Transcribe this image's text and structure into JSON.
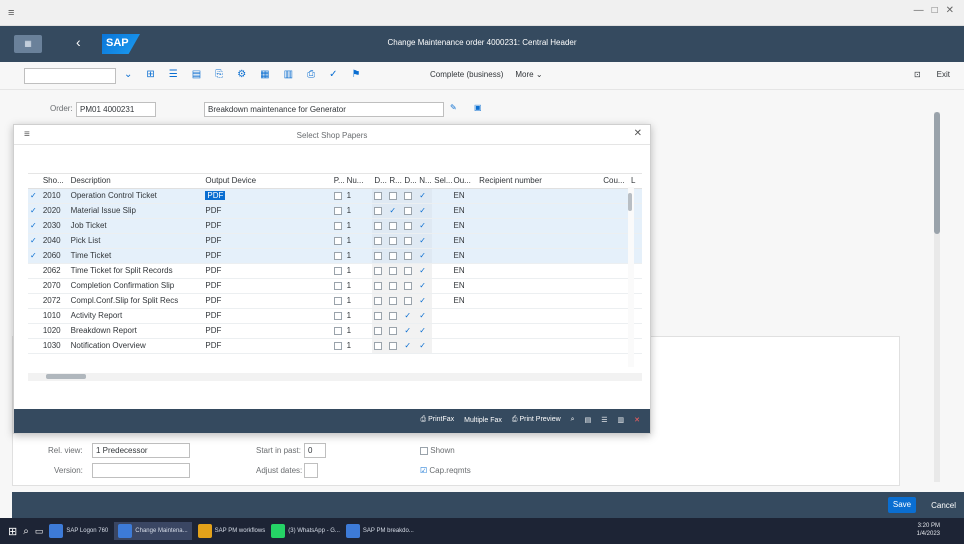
{
  "window": {
    "controls": [
      "—",
      "□",
      "✕"
    ]
  },
  "shell": {
    "title": "Change Maintenance order 4000231: Central Header",
    "logo": "SAP"
  },
  "toolbar": {
    "complete_label": "Complete (business)",
    "more_label": "More",
    "exit_label": "Exit"
  },
  "header": {
    "order_label": "Order:",
    "order_value": "PM01 4000231",
    "description": "Breakdown maintenance for Generator"
  },
  "dialog": {
    "title": "Select Shop Papers",
    "columns": [
      "Sho...",
      "Description",
      "Output Device",
      "P...",
      "Nu...",
      "D...",
      "R...",
      "D...",
      "N...",
      "Sel...",
      "Ou...",
      "Recipient number",
      "Cou...",
      "L"
    ],
    "rows": [
      {
        "sel": true,
        "code": "2010",
        "desc": "Operation Control Ticket",
        "dev": "PDF",
        "num": "1",
        "lang": "EN",
        "flags": [
          false,
          false,
          false,
          true
        ]
      },
      {
        "sel": true,
        "code": "2020",
        "desc": "Material Issue Slip",
        "dev": "PDF",
        "num": "1",
        "lang": "EN",
        "flags": [
          false,
          true,
          false,
          true
        ]
      },
      {
        "sel": true,
        "code": "2030",
        "desc": "Job Ticket",
        "dev": "PDF",
        "num": "1",
        "lang": "EN",
        "flags": [
          false,
          false,
          false,
          true
        ]
      },
      {
        "sel": true,
        "code": "2040",
        "desc": "Pick List",
        "dev": "PDF",
        "num": "1",
        "lang": "EN",
        "flags": [
          false,
          false,
          false,
          true
        ]
      },
      {
        "sel": true,
        "code": "2060",
        "desc": "Time Ticket",
        "dev": "PDF",
        "num": "1",
        "lang": "EN",
        "flags": [
          false,
          false,
          false,
          true
        ]
      },
      {
        "sel": false,
        "code": "2062",
        "desc": "Time Ticket for Split Records",
        "dev": "PDF",
        "num": "1",
        "lang": "EN",
        "flags": [
          false,
          false,
          false,
          true
        ]
      },
      {
        "sel": false,
        "code": "2070",
        "desc": "Completion Confirmation Slip",
        "dev": "PDF",
        "num": "1",
        "lang": "EN",
        "flags": [
          false,
          false,
          false,
          true
        ]
      },
      {
        "sel": false,
        "code": "2072",
        "desc": "Compl.Conf.Slip for Split Recs",
        "dev": "PDF",
        "num": "1",
        "lang": "EN",
        "flags": [
          false,
          false,
          false,
          true
        ]
      },
      {
        "sel": false,
        "code": "1010",
        "desc": "Activity Report",
        "dev": "PDF",
        "num": "1",
        "lang": "",
        "flags": [
          false,
          false,
          true,
          true
        ]
      },
      {
        "sel": false,
        "code": "1020",
        "desc": "Breakdown Report",
        "dev": "PDF",
        "num": "1",
        "lang": "",
        "flags": [
          false,
          false,
          true,
          true
        ]
      },
      {
        "sel": false,
        "code": "1030",
        "desc": "Notification Overview",
        "dev": "PDF",
        "num": "1",
        "lang": "",
        "flags": [
          false,
          false,
          true,
          true
        ]
      }
    ],
    "footer": {
      "printfax": "PrintFax",
      "multiple_fax": "Multiple Fax",
      "print_preview": "Print Preview"
    }
  },
  "lower": {
    "rel_view_label": "Rel. view:",
    "rel_view_value": "1 Predecessor",
    "version_label": "Version:",
    "start_label": "Start in past:",
    "start_value": "0",
    "adjust_label": "Adjust dates:",
    "shown_label": "Shown",
    "cap_reqmts_label": "Cap.reqmts"
  },
  "footer": {
    "save_label": "Save",
    "cancel_label": "Cancel"
  },
  "taskbar": {
    "items": [
      "SAP Logon 760",
      "Change Maintena...",
      "SAP PM workflows",
      "(3) WhatsApp - G...",
      "SAP PM breakdo..."
    ],
    "time": "3:20 PM",
    "date": "1/4/2023"
  }
}
